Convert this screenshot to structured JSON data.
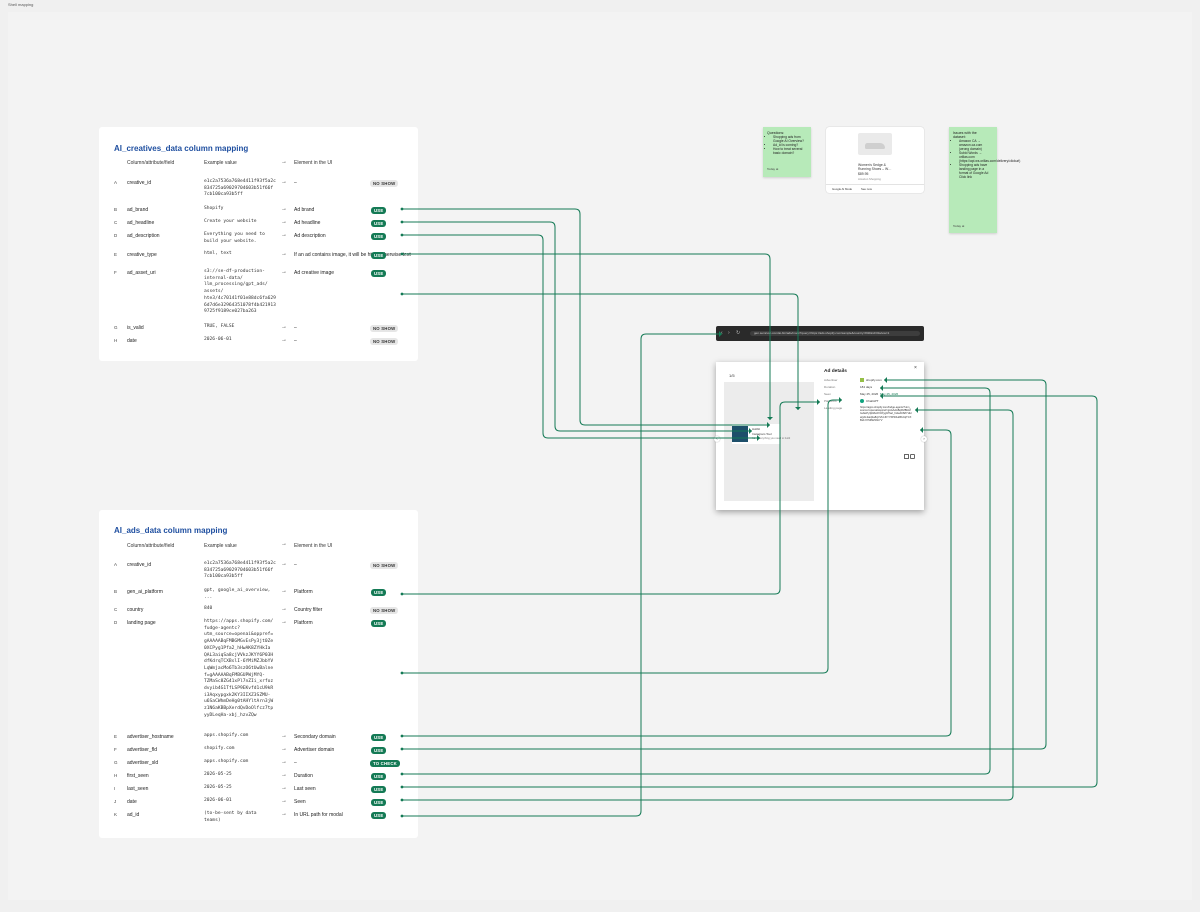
{
  "frame": {
    "label": "Shell mapping"
  },
  "creatives_table": {
    "title": "AI_creatives_data column mapping",
    "headers": {
      "column": "Column/attribute/field",
      "example": "Example value",
      "ui": "Element in the UI"
    },
    "rows": [
      {
        "letter": "A",
        "name": "creative_id",
        "example": "e1c2a7536a768e4411f93f5a2c\n834725a69029704603b51f66f\n7cb100ca93b5ff",
        "ui": "–",
        "status": "NO SHOW"
      },
      {
        "letter": "B",
        "name": "ad_brand",
        "example": "Shopify",
        "ui": "Ad brand",
        "status": "USE"
      },
      {
        "letter": "C",
        "name": "ad_headline",
        "example": "Create your website",
        "ui": "Ad headline",
        "status": "USE"
      },
      {
        "letter": "D",
        "name": "ad_description",
        "example": "Everything you need to\nbuild your website.",
        "ui": "Ad description",
        "status": "USE"
      },
      {
        "letter": "E",
        "name": "creative_type",
        "example": "html, text",
        "ui": "If an ad contains image, it will\nbe html, otherwise text",
        "status": "USE"
      },
      {
        "letter": "F",
        "name": "ad_asset_uri",
        "example": "s3://se-df-production-\ninternal-data/\nllm_processing/gpt_ads/\nassets/\nhte3/4c70141f01e88dc6fa629\n6d7d6e32964351078f4b421913\n9725f9189ce027ba263",
        "ui": "Ad creative image",
        "status": "USE"
      },
      {
        "letter": "G",
        "name": "is_valid",
        "example": "TRUE, FALSE",
        "ui": "–",
        "status": "NO SHOW"
      },
      {
        "letter": "H",
        "name": "date",
        "example": "2026-06-01",
        "ui": "–",
        "status": "NO SHOW"
      }
    ]
  },
  "ads_table": {
    "title": "AI_ads_data column mapping",
    "headers": {
      "column": "Column/attribute/field",
      "example": "Example value",
      "ui": "Element in the UI"
    },
    "rows": [
      {
        "letter": "A",
        "name": "creative_id",
        "example": "e1c2a7536a768e4411f93f5a2c\n834725a69029704603b51f66f\n7cb100ca93b5ff",
        "ui": "–",
        "status": "NO SHOW"
      },
      {
        "letter": "B",
        "name": "gen_ai_platform",
        "example": "gpt, google_ai_overview,\n...",
        "ui": "Platform",
        "status": "USE"
      },
      {
        "letter": "C",
        "name": "country",
        "example": "840",
        "ui": "Country filter",
        "status": "NO SHOW"
      },
      {
        "letter": "D",
        "name": "landing page",
        "example": "https://apps.shopify.com/\nfudge-agentc?\nutm_source=openai&oppref=\ngAAAAABqFMBGMGvEsPy3jt0Ze\n0XCPyg1Pfa2_hHwAK8ZYHkIa\nQAL3aiqSa8cjVVkzJKYY6P03H\ndfKdrqTCXBslI-6YMiMZJbbYV\nLqWmjacMo6Tb3szO6tUwBalne\nf=gAAAAABqFMBGUPWjMYQ-\nTZMaSc8ZG41xPl7nZIi_xrfoz\ndvyib4G1TfLSP9EKvfd1cU9kR\ni3Aqxypgxk2KY3IIXZ3SZMU-\nu6SaCWhmDeHg0tAHYltArn3jW\nz1N6aKBBpXerdQvDoOlfcz7tp\nyyDLeqHa-xbj_hzvZQw",
        "ui": "Platform",
        "status": "USE"
      },
      {
        "letter": "E",
        "name": "advertiser_hostname",
        "example": "apps.shopify.com",
        "ui": "Secondary domain",
        "status": "USE"
      },
      {
        "letter": "F",
        "name": "advertiser_fld",
        "example": "shopify.com",
        "ui": "Advertiser domain",
        "status": "USE"
      },
      {
        "letter": "G",
        "name": "advertiser_sld",
        "example": "apps.shopify.com",
        "ui": "–",
        "status": "TO CHECK"
      },
      {
        "letter": "H",
        "name": "first_seen",
        "example": "2026-05-25",
        "ui": "Duration",
        "status": "USE"
      },
      {
        "letter": "I",
        "name": "last_seen",
        "example": "2026-05-25",
        "ui": "Last seen",
        "status": "USE"
      },
      {
        "letter": "J",
        "name": "date",
        "example": "2026-06-01",
        "ui": "Seen",
        "status": "USE"
      },
      {
        "letter": "K",
        "name": "ad_id",
        "example": "(to-be-sent by data\nteams)",
        "ui": "In URL path for modal",
        "status": "USE"
      }
    ]
  },
  "sticky_questions": {
    "title": "Questions:",
    "items": [
      "Shopping ads from Google AI Overview?",
      "Ad_id is coming?",
      "How to treat several basic domain?"
    ],
    "footer": "Today at"
  },
  "sticky_issues": {
    "title": "Issues with the dataset:",
    "items": [
      "Amazon CA → amazon.ca.com (wrong domain)",
      "Subid Words → orillas.com (https://api.ws.orillas.com/delivery/clickurl)",
      "Shopping ads have landing page in a format of Google Ad Click link"
    ],
    "footer": "Today at"
  },
  "product_card": {
    "title": "Women's Sedge & Running Shoes – W…",
    "price": "$89.95",
    "store": "Amazon Shopping",
    "footer_left": "Google AI Mode",
    "footer_mid": "See now"
  },
  "browser": {
    "url": "gen.semrush.com/ai-bin/ads/mock?query=https://ads.shopify.com/sample&country=840&id=0&view=1"
  },
  "modal": {
    "counter": "1/5",
    "heading": "Ad details",
    "labels": [
      "Advertiser",
      "Duration",
      "Seen",
      "Platforms",
      "Landing page"
    ],
    "advertiser": "shopify.com",
    "duration": "184 days",
    "seen": "May 25, 2026",
    "seen_extra": "May 25, 2026",
    "platform": "ChatGPT",
    "landing": "https://apps.shopify.com/fudge-agentc?utm_source=openai&oppref=gAAAAABqFMBGMGvEsPy3jt0Ze0XCPyg1Pfa2_hHwAK8ZYHkIaQAL3aiqSa8cjVVkzJKYY6P03HdfKdrqTCXBslI-6YMiMZJbbYV",
    "ad_name": "Hobbit",
    "ad_headline": "Instagram Tool",
    "ad_desc": "Ad · Everything you need to build"
  },
  "colors": {
    "accent": "#147a55",
    "title_blue": "#1f4fa0",
    "sticky": "#b7eab9"
  }
}
